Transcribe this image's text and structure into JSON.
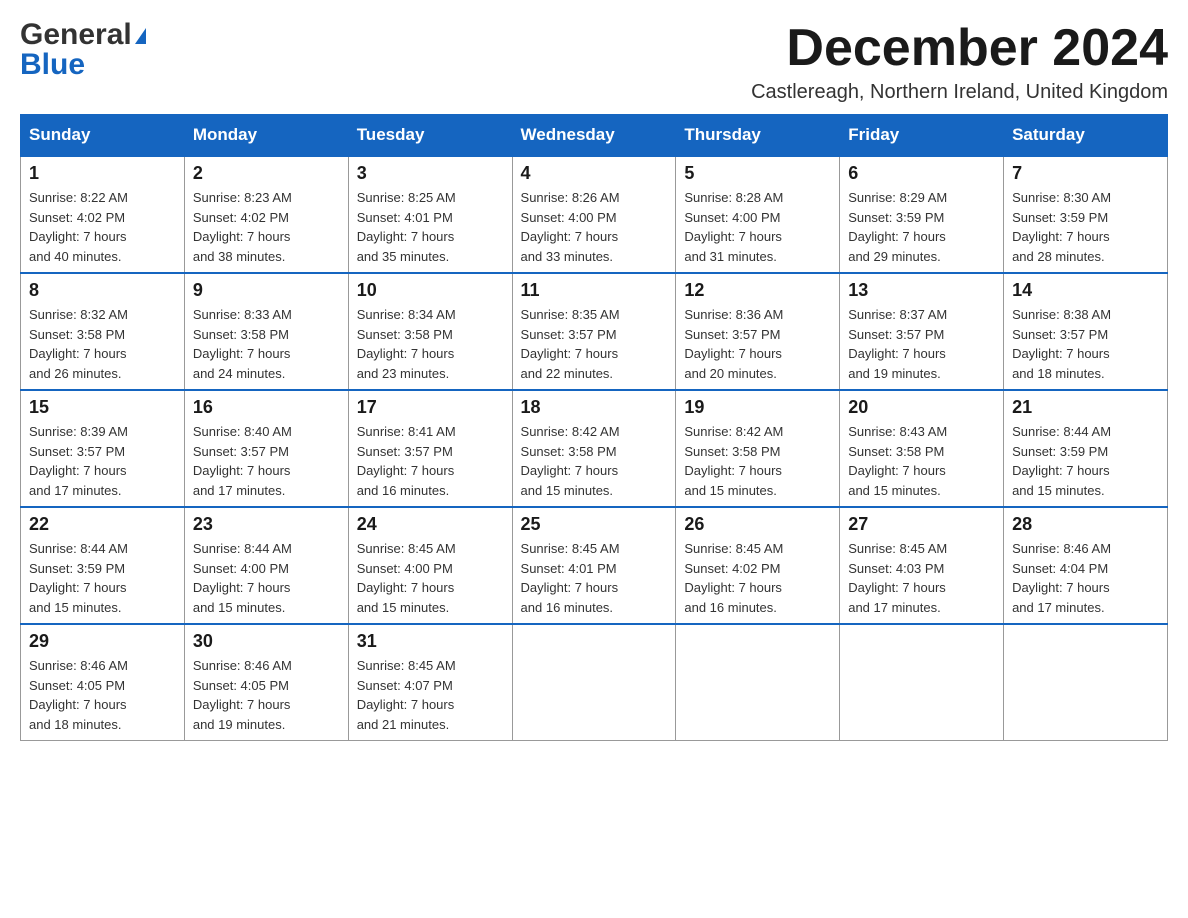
{
  "logo": {
    "general": "General",
    "triangle": "▲",
    "blue": "Blue"
  },
  "title": "December 2024",
  "location": "Castlereagh, Northern Ireland, United Kingdom",
  "headers": [
    "Sunday",
    "Monday",
    "Tuesday",
    "Wednesday",
    "Thursday",
    "Friday",
    "Saturday"
  ],
  "weeks": [
    [
      {
        "day": "1",
        "sunrise": "8:22 AM",
        "sunset": "4:02 PM",
        "daylight": "7 hours and 40 minutes."
      },
      {
        "day": "2",
        "sunrise": "8:23 AM",
        "sunset": "4:02 PM",
        "daylight": "7 hours and 38 minutes."
      },
      {
        "day": "3",
        "sunrise": "8:25 AM",
        "sunset": "4:01 PM",
        "daylight": "7 hours and 35 minutes."
      },
      {
        "day": "4",
        "sunrise": "8:26 AM",
        "sunset": "4:00 PM",
        "daylight": "7 hours and 33 minutes."
      },
      {
        "day": "5",
        "sunrise": "8:28 AM",
        "sunset": "4:00 PM",
        "daylight": "7 hours and 31 minutes."
      },
      {
        "day": "6",
        "sunrise": "8:29 AM",
        "sunset": "3:59 PM",
        "daylight": "7 hours and 29 minutes."
      },
      {
        "day": "7",
        "sunrise": "8:30 AM",
        "sunset": "3:59 PM",
        "daylight": "7 hours and 28 minutes."
      }
    ],
    [
      {
        "day": "8",
        "sunrise": "8:32 AM",
        "sunset": "3:58 PM",
        "daylight": "7 hours and 26 minutes."
      },
      {
        "day": "9",
        "sunrise": "8:33 AM",
        "sunset": "3:58 PM",
        "daylight": "7 hours and 24 minutes."
      },
      {
        "day": "10",
        "sunrise": "8:34 AM",
        "sunset": "3:58 PM",
        "daylight": "7 hours and 23 minutes."
      },
      {
        "day": "11",
        "sunrise": "8:35 AM",
        "sunset": "3:57 PM",
        "daylight": "7 hours and 22 minutes."
      },
      {
        "day": "12",
        "sunrise": "8:36 AM",
        "sunset": "3:57 PM",
        "daylight": "7 hours and 20 minutes."
      },
      {
        "day": "13",
        "sunrise": "8:37 AM",
        "sunset": "3:57 PM",
        "daylight": "7 hours and 19 minutes."
      },
      {
        "day": "14",
        "sunrise": "8:38 AM",
        "sunset": "3:57 PM",
        "daylight": "7 hours and 18 minutes."
      }
    ],
    [
      {
        "day": "15",
        "sunrise": "8:39 AM",
        "sunset": "3:57 PM",
        "daylight": "7 hours and 17 minutes."
      },
      {
        "day": "16",
        "sunrise": "8:40 AM",
        "sunset": "3:57 PM",
        "daylight": "7 hours and 17 minutes."
      },
      {
        "day": "17",
        "sunrise": "8:41 AM",
        "sunset": "3:57 PM",
        "daylight": "7 hours and 16 minutes."
      },
      {
        "day": "18",
        "sunrise": "8:42 AM",
        "sunset": "3:58 PM",
        "daylight": "7 hours and 15 minutes."
      },
      {
        "day": "19",
        "sunrise": "8:42 AM",
        "sunset": "3:58 PM",
        "daylight": "7 hours and 15 minutes."
      },
      {
        "day": "20",
        "sunrise": "8:43 AM",
        "sunset": "3:58 PM",
        "daylight": "7 hours and 15 minutes."
      },
      {
        "day": "21",
        "sunrise": "8:44 AM",
        "sunset": "3:59 PM",
        "daylight": "7 hours and 15 minutes."
      }
    ],
    [
      {
        "day": "22",
        "sunrise": "8:44 AM",
        "sunset": "3:59 PM",
        "daylight": "7 hours and 15 minutes."
      },
      {
        "day": "23",
        "sunrise": "8:44 AM",
        "sunset": "4:00 PM",
        "daylight": "7 hours and 15 minutes."
      },
      {
        "day": "24",
        "sunrise": "8:45 AM",
        "sunset": "4:00 PM",
        "daylight": "7 hours and 15 minutes."
      },
      {
        "day": "25",
        "sunrise": "8:45 AM",
        "sunset": "4:01 PM",
        "daylight": "7 hours and 16 minutes."
      },
      {
        "day": "26",
        "sunrise": "8:45 AM",
        "sunset": "4:02 PM",
        "daylight": "7 hours and 16 minutes."
      },
      {
        "day": "27",
        "sunrise": "8:45 AM",
        "sunset": "4:03 PM",
        "daylight": "7 hours and 17 minutes."
      },
      {
        "day": "28",
        "sunrise": "8:46 AM",
        "sunset": "4:04 PM",
        "daylight": "7 hours and 17 minutes."
      }
    ],
    [
      {
        "day": "29",
        "sunrise": "8:46 AM",
        "sunset": "4:05 PM",
        "daylight": "7 hours and 18 minutes."
      },
      {
        "day": "30",
        "sunrise": "8:46 AM",
        "sunset": "4:05 PM",
        "daylight": "7 hours and 19 minutes."
      },
      {
        "day": "31",
        "sunrise": "8:45 AM",
        "sunset": "4:07 PM",
        "daylight": "7 hours and 21 minutes."
      },
      null,
      null,
      null,
      null
    ]
  ]
}
